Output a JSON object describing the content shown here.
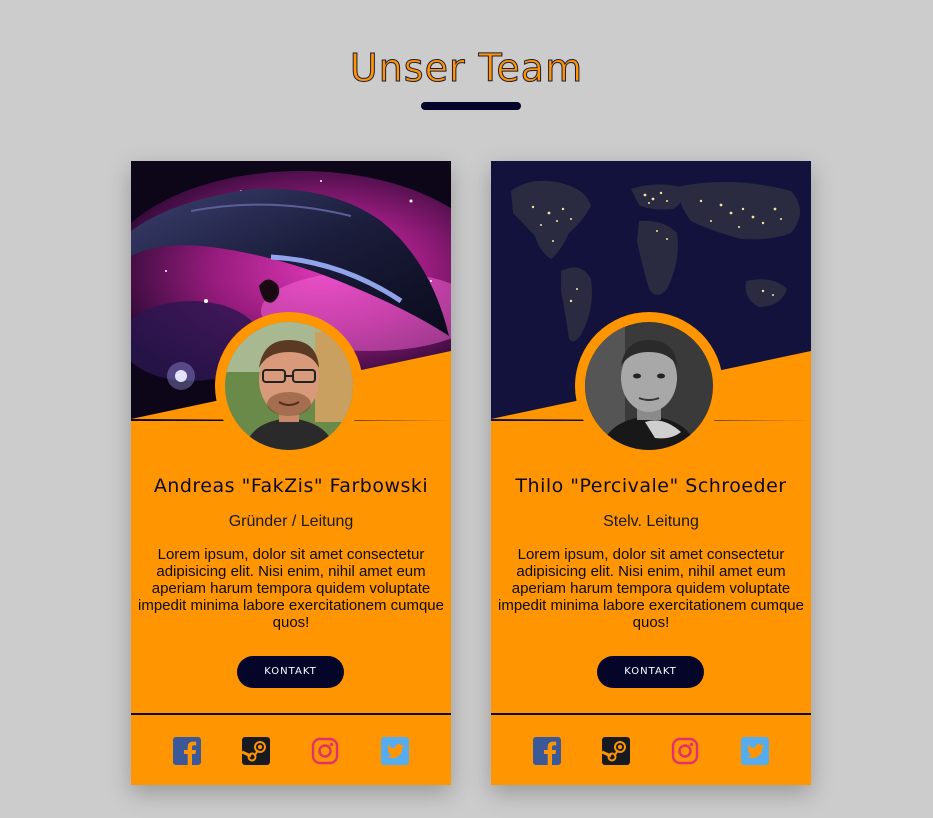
{
  "page": {
    "title": "Unser Team"
  },
  "colors": {
    "accent": "#ff9500",
    "dark": "#05052a",
    "background": "#cccccc",
    "facebook": "#3b5998",
    "steam": "#171a21",
    "instagram": "#e1306c",
    "twitter": "#55acee"
  },
  "members": [
    {
      "name": "Andreas \"FakZis\" Farbowski",
      "role": "Gründer / Leitung",
      "bio": "Lorem ipsum, dolor sit amet consectetur adipisicing elit. Nisi enim, nihil amet eum aperiam harum tempora quidem voluptate impedit minima labore exercitationem cumque quos!",
      "contact_label": "KONTAKT",
      "banner": "space-nebula-spaceship",
      "photo": "man-with-glasses-portrait",
      "social": [
        "facebook-icon",
        "steam-icon",
        "instagram-icon",
        "twitter-icon"
      ]
    },
    {
      "name": "Thilo \"Percivale\" Schroeder",
      "role": "Stelv. Leitung",
      "bio": "Lorem ipsum, dolor sit amet consectetur adipisicing elit. Nisi enim, nihil amet eum aperiam harum tempora quidem voluptate impedit minima labore exercitationem cumque quos!",
      "contact_label": "KONTAKT",
      "banner": "world-map-night-lights",
      "photo": "man-black-and-white-portrait",
      "social": [
        "facebook-icon",
        "steam-icon",
        "instagram-icon",
        "twitter-icon"
      ]
    }
  ]
}
